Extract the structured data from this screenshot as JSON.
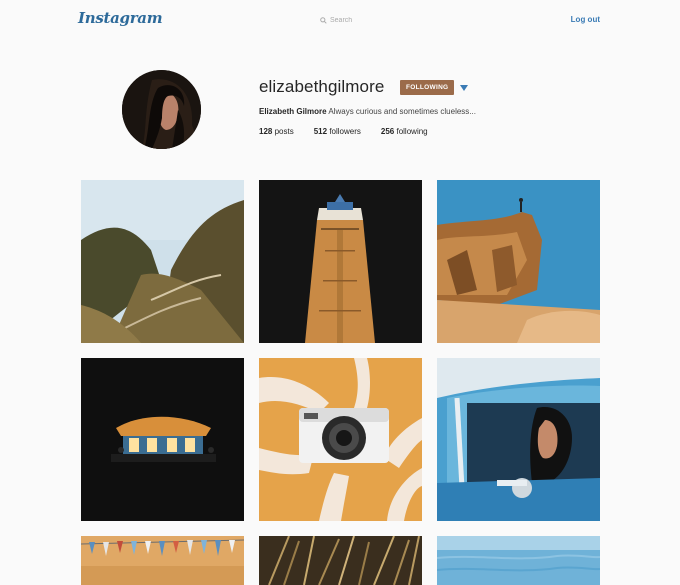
{
  "header": {
    "logo": "Instagram",
    "search_placeholder": "Search",
    "logout_label": "Log out"
  },
  "profile": {
    "username": "elizabethgilmore",
    "follow_button_label": "FOLLOWING",
    "full_name": "Elizabeth Gilmore",
    "bio": "Always curious and sometimes clueless...",
    "posts_count": "128",
    "posts_label": "posts",
    "followers_count": "512",
    "followers_label": "followers",
    "following_count": "256",
    "following_label": "following"
  },
  "colors": {
    "brand_blue": "#3a7bb5",
    "following_button": "#9b6b4a",
    "background": "#fafafa"
  },
  "icons": {
    "search": "search-icon",
    "dropdown": "caret-down-icon"
  }
}
